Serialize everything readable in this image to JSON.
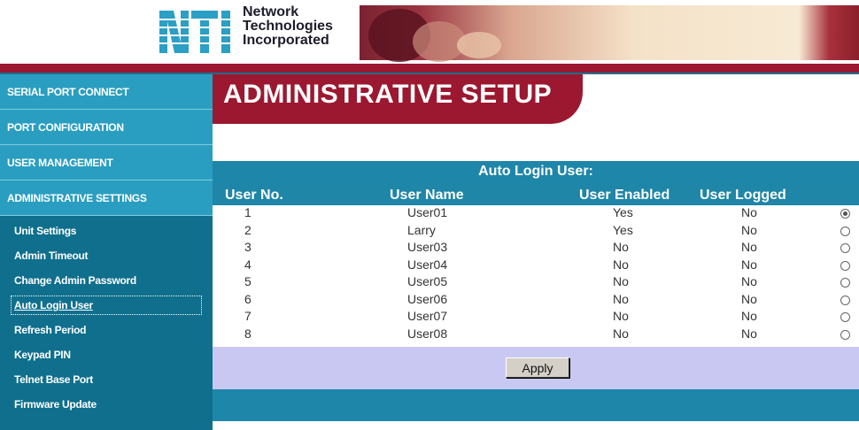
{
  "brand": {
    "logo_mark": "NTI",
    "name_lines": [
      "Network",
      "Technologies",
      "Incorporated"
    ]
  },
  "sidebar": {
    "main_items": [
      {
        "label": "SERIAL PORT CONNECT"
      },
      {
        "label": "PORT CONFIGURATION"
      },
      {
        "label": "USER MANAGEMENT"
      },
      {
        "label": "ADMINISTRATIVE SETTINGS"
      }
    ],
    "sub_items": [
      {
        "label": "Unit Settings"
      },
      {
        "label": "Admin Timeout"
      },
      {
        "label": "Change Admin Password"
      },
      {
        "label": "Auto Login User",
        "active": true
      },
      {
        "label": "Refresh Period"
      },
      {
        "label": "Keypad PIN"
      },
      {
        "label": "Telnet Base Port"
      },
      {
        "label": "Firmware Update"
      }
    ]
  },
  "page": {
    "title": "ADMINISTRATIVE SETUP"
  },
  "panel": {
    "title": "Auto Login User:",
    "columns": [
      "User No.",
      "User Name",
      "User Enabled",
      "User Logged"
    ],
    "rows": [
      {
        "no": "1",
        "name": "User01",
        "enabled": "Yes",
        "logged": "No",
        "selected": true
      },
      {
        "no": "2",
        "name": "Larry",
        "enabled": "Yes",
        "logged": "No",
        "selected": false
      },
      {
        "no": "3",
        "name": "User03",
        "enabled": "No",
        "logged": "No",
        "selected": false
      },
      {
        "no": "4",
        "name": "User04",
        "enabled": "No",
        "logged": "No",
        "selected": false
      },
      {
        "no": "5",
        "name": "User05",
        "enabled": "No",
        "logged": "No",
        "selected": false
      },
      {
        "no": "6",
        "name": "User06",
        "enabled": "No",
        "logged": "No",
        "selected": false
      },
      {
        "no": "7",
        "name": "User07",
        "enabled": "No",
        "logged": "No",
        "selected": false
      },
      {
        "no": "8",
        "name": "User08",
        "enabled": "No",
        "logged": "No",
        "selected": false
      }
    ],
    "apply_label": "Apply"
  },
  "colors": {
    "accent_red": "#9b1830",
    "sidebar_teal": "#2a9ec0",
    "sidebar_dark": "#0f6f8d",
    "apply_bar": "#c9c8f2"
  }
}
